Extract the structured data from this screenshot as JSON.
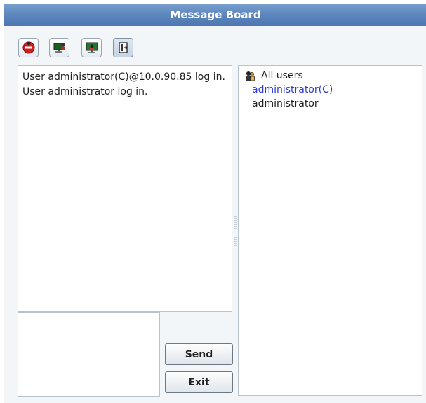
{
  "window": {
    "title": "Message Board"
  },
  "toolbar": {
    "buttons": [
      {
        "icon": "stop-icon",
        "label": ""
      },
      {
        "icon": "user-monitor-icon",
        "label": ""
      },
      {
        "icon": "display-icon",
        "label": ""
      },
      {
        "icon": "exit-door-icon",
        "label": ""
      }
    ]
  },
  "log": {
    "lines": [
      "User administrator(C)@10.0.90.85 log in.",
      "User administrator log in."
    ]
  },
  "users": {
    "root_label": "All users",
    "root_icon": "users-group-icon",
    "items": [
      {
        "name": "administrator(C)",
        "color": "#2d3bd4"
      },
      {
        "name": "administrator",
        "color": "#202020"
      }
    ]
  },
  "compose": {
    "value": ""
  },
  "actions": {
    "send_label": "Send",
    "exit_label": "Exit"
  },
  "colors": {
    "title_bar": "#5d86bf",
    "window_bg": "#f3f6f8",
    "highlight_text": "#2d3bd4"
  }
}
